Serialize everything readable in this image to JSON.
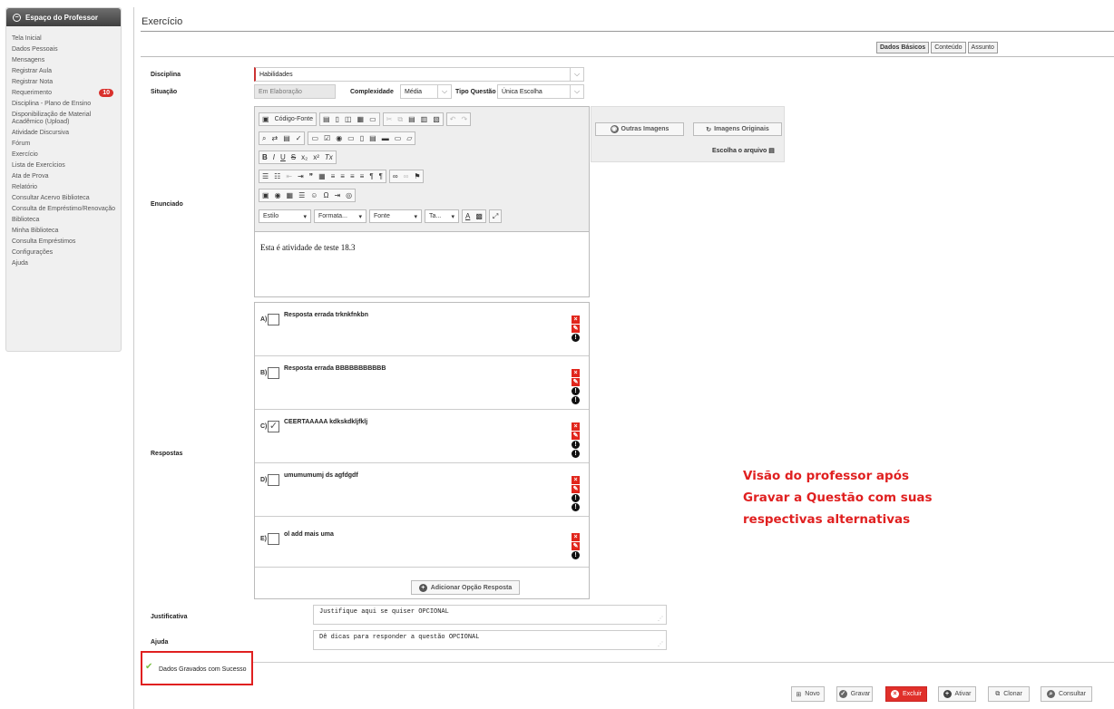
{
  "sidebar": {
    "title": "Espaço do Professor",
    "items": [
      {
        "label": "Tela Inicial"
      },
      {
        "label": "Dados Pessoais"
      },
      {
        "label": "Mensagens"
      },
      {
        "label": "Registrar Aula"
      },
      {
        "label": "Registrar Nota"
      },
      {
        "label": "Requerimento",
        "badge": "10"
      },
      {
        "label": "Disciplina - Plano de Ensino"
      },
      {
        "label": "Disponibilização de Material Acadêmico (Upload)"
      },
      {
        "label": "Atividade Discursiva"
      },
      {
        "label": "Fórum"
      },
      {
        "label": "Exercício"
      },
      {
        "label": "Lista de Exercícios"
      },
      {
        "label": "Ata de Prova"
      },
      {
        "label": "Relatório"
      },
      {
        "label": "Consultar Acervo Biblioteca"
      },
      {
        "label": "Consulta de Empréstimo/Renovação"
      },
      {
        "label": "Biblioteca"
      },
      {
        "label": "Minha Biblioteca"
      },
      {
        "label": "Consulta Empréstimos"
      },
      {
        "label": "Configurações"
      },
      {
        "label": "Ajuda"
      }
    ]
  },
  "page": {
    "title": "Exercício"
  },
  "tabs": [
    "Dados Básicos",
    "Conteúdo",
    "Assunto"
  ],
  "form": {
    "disciplina_label": "Disciplina",
    "disciplina_value": "Habilidades",
    "situacao_label": "Situação",
    "situacao_value": "Em Elaboração",
    "complexidade_label": "Complexidade",
    "complexidade_value": "Média",
    "tipo_label": "Tipo Questão",
    "tipo_value": "Única Escolha",
    "enunciado_label": "Enunciado",
    "enunciado_text": "Esta é atividade de teste 18.3",
    "respostas_label": "Respostas",
    "justificativa_label": "Justificativa",
    "justificativa_placeholder": "Justifique aqui se quiser OPCIONAL",
    "ajuda_label": "Ajuda",
    "ajuda_placeholder": "Dê dicas para responder a questão  OPCIONAL"
  },
  "editor": {
    "source_label": "Código-Fonte",
    "style_label": "Estilo",
    "format_label": "Formata...",
    "font_label": "Fonte",
    "size_label": "Ta..."
  },
  "images": {
    "other_label": "Outras Imagens",
    "original_label": "Imagens Originais",
    "file_label": "Escolha o arquivo"
  },
  "answers": [
    {
      "letter": "A)",
      "text": "Resposta errada  trknkfnkbn",
      "checked": false
    },
    {
      "letter": "B)",
      "text": "Resposta errada BBBBBBBBBBB",
      "checked": false
    },
    {
      "letter": "C)",
      "text": "CEERTAAAAA kdkskdkljfklj",
      "checked": true
    },
    {
      "letter": "D)",
      "text": "umumumumj ds agfdgdf",
      "checked": false
    },
    {
      "letter": "E)",
      "text": "ol add mais uma",
      "checked": false
    }
  ],
  "add_option_label": "Adicionar Opção Resposta",
  "status": {
    "success_message": "Dados Gravados com Sucesso"
  },
  "annotation": {
    "lines": [
      "Visão do professor após",
      "Gravar a Questão com suas",
      "respectivas alternativas"
    ]
  },
  "footer_buttons": {
    "novo": "Novo",
    "gravar": "Gravar",
    "excluir": "Excluir",
    "ativar": "Ativar",
    "clonar": "Clonar",
    "consultar": "Consultar"
  },
  "colors": {
    "accent_red": "#e02020",
    "danger": "#e0302a",
    "success": "#7bbf44"
  }
}
